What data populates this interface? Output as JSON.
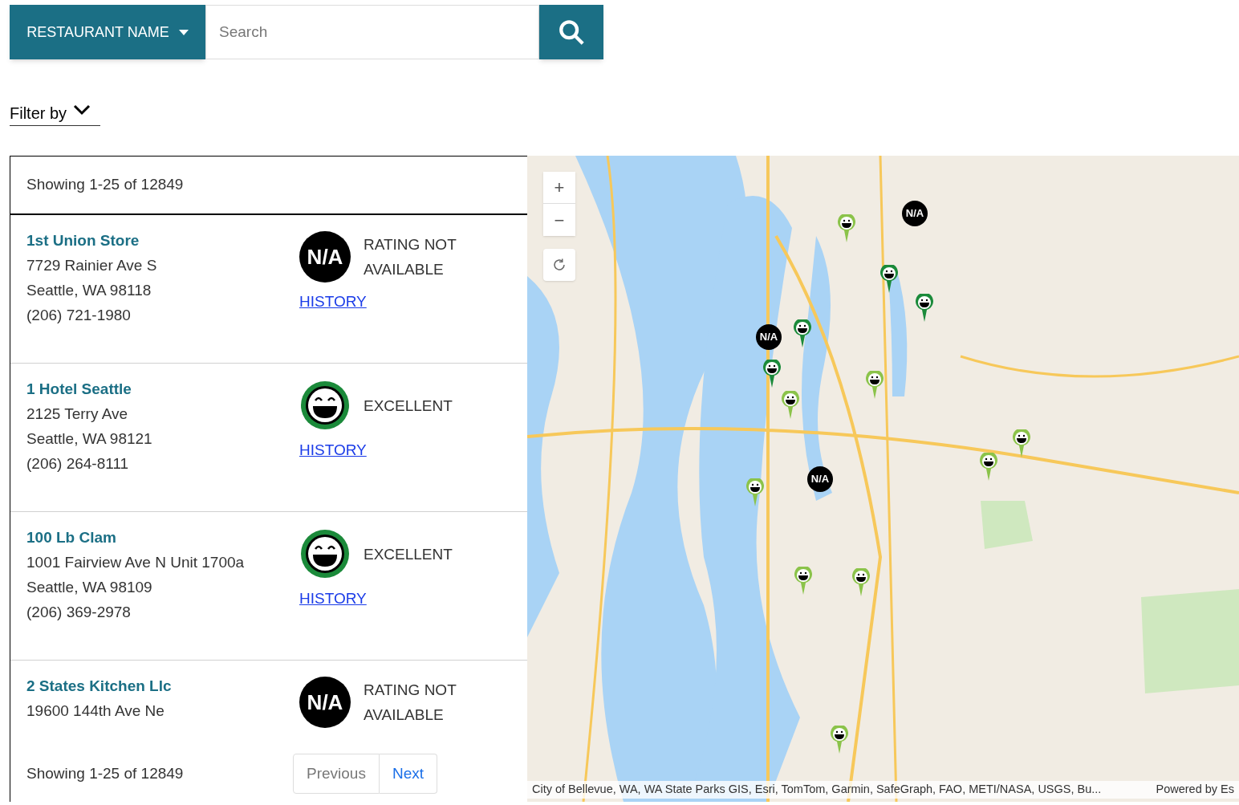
{
  "search": {
    "category": "RESTAURANT NAME",
    "placeholder": "Search"
  },
  "filter": {
    "label": "Filter by"
  },
  "list": {
    "summary": "Showing 1-25 of 12849",
    "rows": [
      {
        "name": "1st Union Store",
        "address": "7729 Rainier Ave S",
        "city": "Seattle, WA 98118",
        "phone": "(206) 721-1980",
        "rating": {
          "kind": "na",
          "badge": "N/A",
          "label": "RATING NOT AVAILABLE"
        },
        "history": "HISTORY"
      },
      {
        "name": "1 Hotel Seattle",
        "address": "2125 Terry Ave",
        "city": "Seattle, WA 98121",
        "phone": "(206) 264-8111",
        "rating": {
          "kind": "excellent",
          "label": "EXCELLENT"
        },
        "history": "HISTORY"
      },
      {
        "name": "100 Lb Clam",
        "address": "1001 Fairview Ave N Unit 1700a",
        "city": "Seattle, WA 98109",
        "phone": "(206) 369-2978",
        "rating": {
          "kind": "excellent",
          "label": "EXCELLENT"
        },
        "history": "HISTORY"
      },
      {
        "name": "2 States Kitchen Llc",
        "address": "19600 144th Ave Ne",
        "rating": {
          "kind": "na",
          "badge": "N/A",
          "label": "RATING NOT AVAILABLE"
        }
      }
    ],
    "footer": {
      "summary": "Showing 1-25 of 12849",
      "pages": [
        {
          "label": "Previous",
          "disabled": true
        },
        {
          "label": "Next",
          "disabled": false
        }
      ]
    }
  },
  "map": {
    "zoom_in": "+",
    "zoom_out": "−",
    "markers": [
      {
        "kind": "smile",
        "color": "#8bc34a"
      },
      {
        "kind": "na",
        "badge": "N/A"
      },
      {
        "kind": "smile",
        "color": "#1b8a3a"
      },
      {
        "kind": "smile",
        "color": "#1b8a3a"
      },
      {
        "kind": "smile",
        "color": "#1b8a3a"
      },
      {
        "kind": "na",
        "badge": "N/A"
      },
      {
        "kind": "smile",
        "color": "#1b8a3a"
      },
      {
        "kind": "smile",
        "color": "#8bc34a"
      },
      {
        "kind": "smile",
        "color": "#8bc34a"
      },
      {
        "kind": "smile",
        "color": "#8bc34a"
      },
      {
        "kind": "smile",
        "color": "#8bc34a"
      },
      {
        "kind": "na",
        "badge": "N/A"
      },
      {
        "kind": "smile",
        "color": "#8bc34a"
      },
      {
        "kind": "smile",
        "color": "#8bc34a"
      },
      {
        "kind": "smile",
        "color": "#8bc34a"
      },
      {
        "kind": "smile",
        "color": "#8bc34a"
      }
    ],
    "attribution": "City of Bellevue, WA, WA State Parks GIS, Esri, TomTom, Garmin, SafeGraph, FAO, METI/NASA, USGS, Bu...",
    "powered": "Powered by Es"
  }
}
